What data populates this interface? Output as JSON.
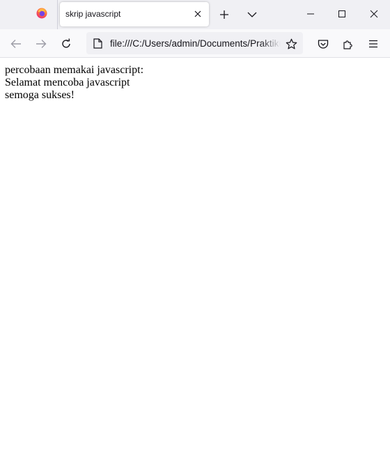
{
  "browser": {
    "tab": {
      "title": "skrip javascript"
    },
    "address_bar": {
      "url": "file:///C:/Users/admin/Documents/Praktikum"
    }
  },
  "page": {
    "lines": [
      "percobaan memakai javascript:",
      "Selamat mencoba javascript",
      "semoga sukses!"
    ]
  },
  "icons": {
    "firefox": "firefox-logo-icon",
    "tab_close": "close-icon",
    "new_tab": "plus-icon",
    "tab_list": "chevron-down-icon",
    "minimize": "minimize-icon",
    "maximize": "maximize-icon",
    "close": "close-icon",
    "back": "arrow-left-icon",
    "forward": "arrow-right-icon",
    "reload": "reload-icon",
    "page": "document-icon",
    "bookmark": "star-icon",
    "pocket": "pocket-icon",
    "extensions": "puzzle-icon",
    "menu": "hamburger-menu-icon"
  }
}
